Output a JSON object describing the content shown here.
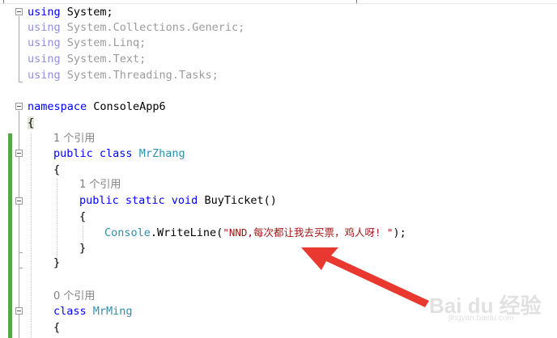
{
  "code_lines": [
    {
      "kw": "using",
      "rest": " System;"
    },
    {
      "kw": "using",
      "rest": " System.Collections.Generic;"
    },
    {
      "kw": "using",
      "rest": " System.Linq;"
    },
    {
      "kw": "using",
      "rest": " System.Text;"
    },
    {
      "kw": "using",
      "rest": " System.Threading.Tasks;"
    },
    {
      "kw": "namespace",
      "rest": " ConsoleApp6"
    },
    {
      "brace": "{"
    },
    {
      "ref": "1 个引用"
    },
    {
      "kw": "public class",
      "type": "MrZhang"
    },
    {
      "brace": "{"
    },
    {
      "ref": "1 个引用"
    },
    {
      "kw": "public static void",
      "rest": " BuyTicket()"
    },
    {
      "brace": "{"
    },
    {
      "type": "Console",
      "rest": ".WriteLine(",
      "str": "\"NND,每次都让我去买票，鸡人呀! \"",
      "end": ");"
    },
    {
      "brace": "}"
    },
    {
      "brace": "}"
    },
    {
      "ref": "0 个引用"
    },
    {
      "kw": "class",
      "type": "MrMing"
    },
    {
      "brace": "{"
    }
  ],
  "watermark": {
    "brand": "Bai du 经验",
    "url": "jingyan.baidu.com"
  },
  "colors": {
    "keyword": "#0000ff",
    "type": "#2b91af",
    "string": "#a31515",
    "reference": "#808080",
    "change_bar": "#57a64a",
    "arrow": "#e8382f"
  }
}
